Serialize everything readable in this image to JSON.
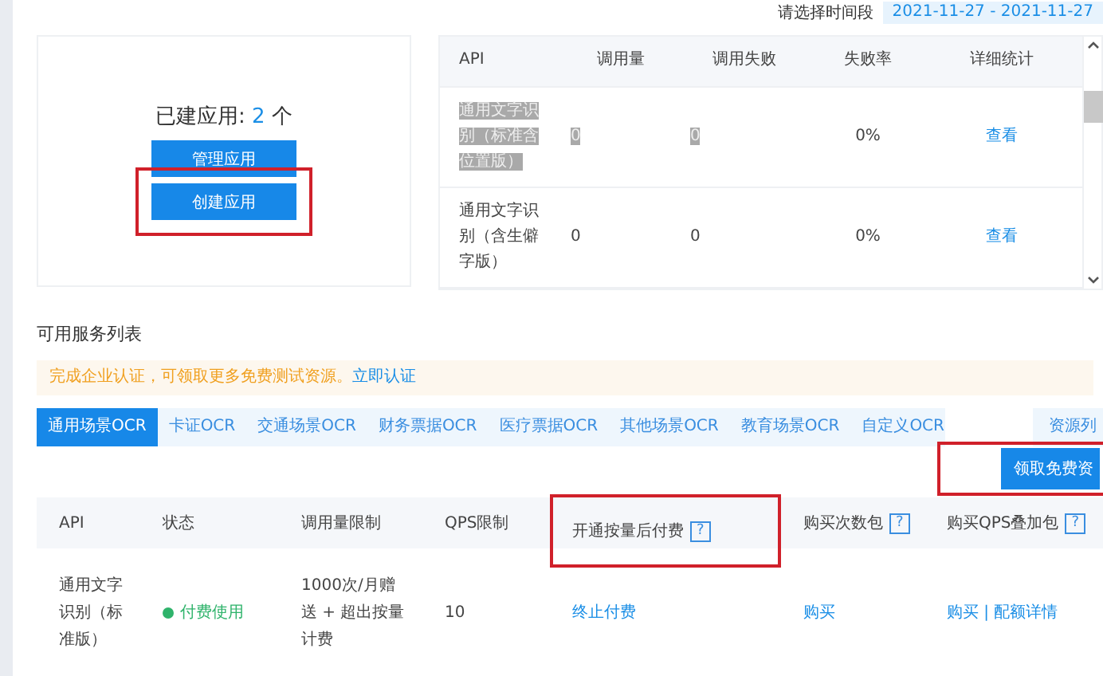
{
  "apps_section": {
    "summary_label": "已建应用:",
    "summary_count": "2",
    "summary_unit": "个",
    "buttons": [
      {
        "label": "管理应用",
        "highlighted": false
      },
      {
        "label": "创建应用",
        "highlighted": true
      }
    ]
  },
  "usage_section": {
    "date_label": "请选择时间段",
    "date_range": "2021-11-27 - 2021-11-27",
    "columns": [
      "API",
      "调用量",
      "调用失败",
      "失败率",
      "详细统计"
    ],
    "rows": [
      {
        "api": "通用文字识别（标准含位置版）",
        "calls": "0",
        "failures": "0",
        "rate": "0%",
        "link": "查看",
        "selected": true
      },
      {
        "api": "通用文字识别（含生僻字版）",
        "calls": "0",
        "failures": "0",
        "rate": "0%",
        "link": "查看",
        "selected": false
      }
    ]
  },
  "services_section": {
    "title": "可用服务列表",
    "notice": "完成企业认证，可领取更多免费测试资源。",
    "notice_link": "立即认证",
    "tabs": [
      {
        "label": "通用场景OCR",
        "selected": true
      },
      {
        "label": "卡证OCR",
        "selected": false
      },
      {
        "label": "交通场景OCR",
        "selected": false
      },
      {
        "label": "财务票据OCR",
        "selected": false
      },
      {
        "label": "医疗票据OCR",
        "selected": false
      },
      {
        "label": "其他场景OCR",
        "selected": false
      },
      {
        "label": "教育场景OCR",
        "selected": false
      },
      {
        "label": "自定义OCR",
        "selected": false
      }
    ],
    "resource_link": "资源列",
    "free_button": {
      "label": "领取免费资",
      "highlighted": true
    },
    "columns": [
      {
        "label": "API",
        "help": false,
        "highlighted": false
      },
      {
        "label": "状态",
        "help": false,
        "highlighted": false
      },
      {
        "label": "调用量限制",
        "help": false,
        "highlighted": false
      },
      {
        "label": "QPS限制",
        "help": false,
        "highlighted": false
      },
      {
        "label": "开通按量后付费",
        "help": true,
        "highlighted": true
      },
      {
        "label": "购买次数包",
        "help": true,
        "highlighted": false
      },
      {
        "label": "购买QPS叠加包",
        "help": true,
        "highlighted": false
      }
    ],
    "help_mark": "?",
    "rows": [
      {
        "api": "通用文字识别（标准版）",
        "status": "付费使用",
        "color": "#2fb36b",
        "limit": "1000次/月赠送 + 超出按量计费",
        "qps": "10",
        "postpay": "终止付费",
        "pack": "购买",
        "qps_pack": "购买 | 配额详情"
      }
    ]
  }
}
